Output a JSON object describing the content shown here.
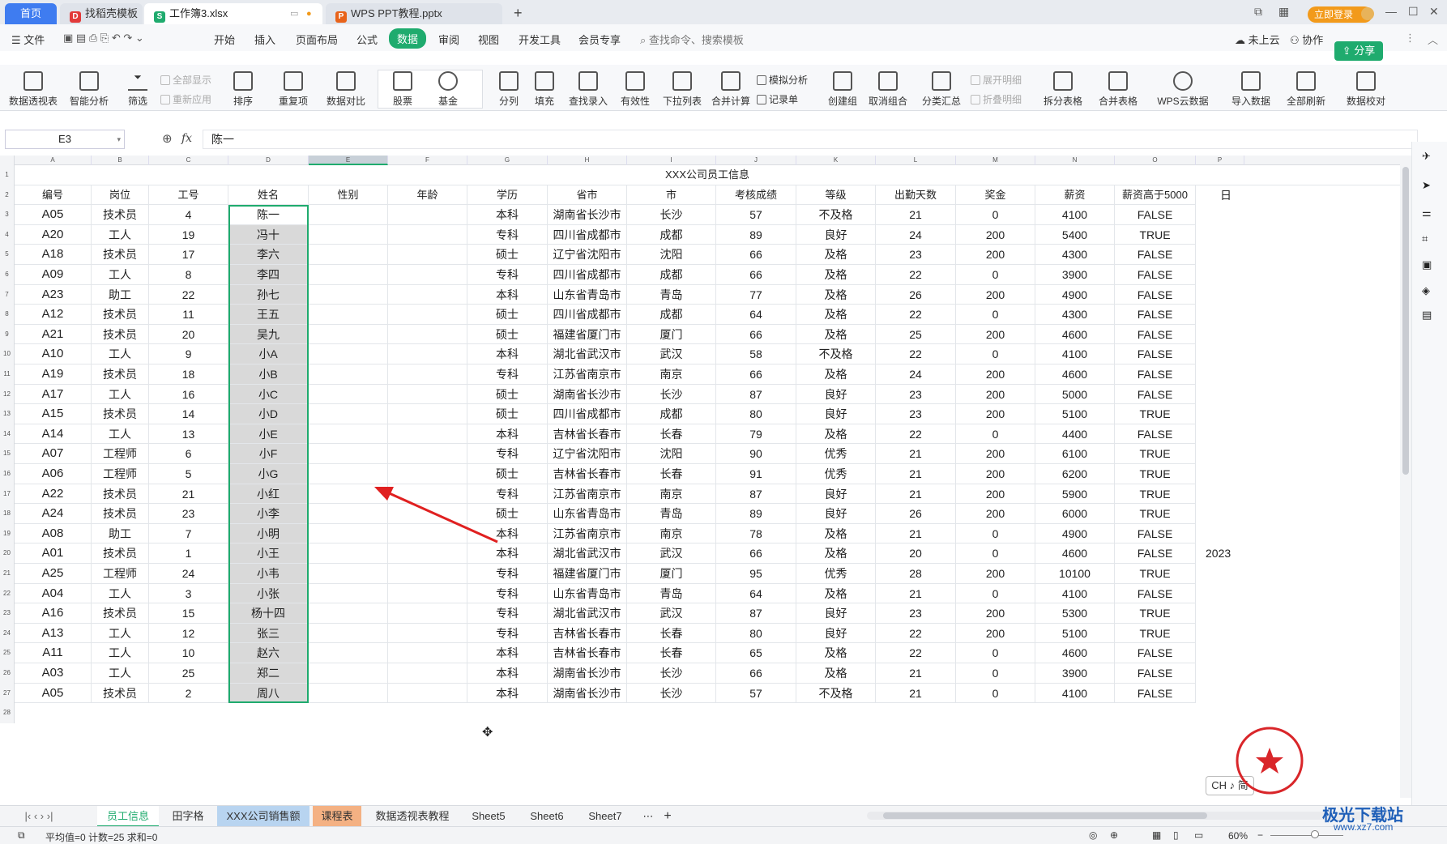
{
  "window": {
    "tabs": [
      {
        "label": "首页"
      },
      {
        "label": "找稻壳模板"
      },
      {
        "label": "工作簿3.xlsx"
      },
      {
        "label": "WPS PPT教程.pptx"
      }
    ],
    "login_label": "立即登录"
  },
  "menu": {
    "file": "文件",
    "items": [
      "开始",
      "插入",
      "页面布局",
      "公式",
      "数据",
      "审阅",
      "视图",
      "开发工具",
      "会员专享"
    ],
    "search_placeholder": "查找命令、搜索模板",
    "cloud": "未上云",
    "collab": "协作",
    "share": "分享"
  },
  "ribbon": {
    "big": [
      "数据透视表",
      "智能分析",
      "筛选",
      "排序",
      "重复项",
      "数据对比",
      "股票",
      "基金",
      "分列",
      "填充",
      "查找录入",
      "有效性",
      "下拉列表",
      "合并计算",
      "创建组",
      "取消组合",
      "分类汇总",
      "拆分表格",
      "合并表格",
      "WPS云数据",
      "导入数据",
      "全部刷新",
      "数据校对"
    ],
    "small": {
      "show_all": "全部显示",
      "reapply": "重新应用",
      "simulate": "模拟分析",
      "record": "记录单",
      "expand": "展开明细",
      "collapse": "折叠明细"
    }
  },
  "formula_bar": {
    "cell_ref": "E3",
    "fx": "fx",
    "value": "陈一"
  },
  "sheet": {
    "col_letters": [
      "A",
      "B",
      "C",
      "D",
      "E",
      "F",
      "G",
      "H",
      "I",
      "J",
      "K",
      "L",
      "M",
      "N",
      "O",
      "P"
    ],
    "title": "XXX公司员工信息",
    "headers": [
      "编号",
      "岗位",
      "工号",
      "姓名",
      "性别",
      "年龄",
      "学历",
      "省市",
      "市",
      "考核成绩",
      "等级",
      "出勤天数",
      "奖金",
      "薪资",
      "薪资高于5000"
    ],
    "rows": [
      [
        "A05",
        "技术员",
        "4",
        "陈一",
        "",
        "",
        "本科",
        "湖南省长沙市",
        "长沙",
        "57",
        "不及格",
        "21",
        "0",
        "4100",
        "FALSE"
      ],
      [
        "A20",
        "工人",
        "19",
        "冯十",
        "",
        "",
        "专科",
        "四川省成都市",
        "成都",
        "89",
        "良好",
        "24",
        "200",
        "5400",
        "TRUE"
      ],
      [
        "A18",
        "技术员",
        "17",
        "李六",
        "",
        "",
        "硕士",
        "辽宁省沈阳市",
        "沈阳",
        "66",
        "及格",
        "23",
        "200",
        "4300",
        "FALSE"
      ],
      [
        "A09",
        "工人",
        "8",
        "李四",
        "",
        "",
        "专科",
        "四川省成都市",
        "成都",
        "66",
        "及格",
        "22",
        "0",
        "3900",
        "FALSE"
      ],
      [
        "A23",
        "助工",
        "22",
        "孙七",
        "",
        "",
        "本科",
        "山东省青岛市",
        "青岛",
        "77",
        "及格",
        "26",
        "200",
        "4900",
        "FALSE"
      ],
      [
        "A12",
        "技术员",
        "11",
        "王五",
        "",
        "",
        "硕士",
        "四川省成都市",
        "成都",
        "64",
        "及格",
        "22",
        "0",
        "4300",
        "FALSE"
      ],
      [
        "A21",
        "技术员",
        "20",
        "吴九",
        "",
        "",
        "硕士",
        "福建省厦门市",
        "厦门",
        "66",
        "及格",
        "25",
        "200",
        "4600",
        "FALSE"
      ],
      [
        "A10",
        "工人",
        "9",
        "小A",
        "",
        "",
        "本科",
        "湖北省武汉市",
        "武汉",
        "58",
        "不及格",
        "22",
        "0",
        "4100",
        "FALSE"
      ],
      [
        "A19",
        "技术员",
        "18",
        "小B",
        "",
        "",
        "专科",
        "江苏省南京市",
        "南京",
        "66",
        "及格",
        "24",
        "200",
        "4600",
        "FALSE"
      ],
      [
        "A17",
        "工人",
        "16",
        "小C",
        "",
        "",
        "硕士",
        "湖南省长沙市",
        "长沙",
        "87",
        "良好",
        "23",
        "200",
        "5000",
        "FALSE"
      ],
      [
        "A15",
        "技术员",
        "14",
        "小D",
        "",
        "",
        "硕士",
        "四川省成都市",
        "成都",
        "80",
        "良好",
        "23",
        "200",
        "5100",
        "TRUE"
      ],
      [
        "A14",
        "工人",
        "13",
        "小E",
        "",
        "",
        "本科",
        "吉林省长春市",
        "长春",
        "79",
        "及格",
        "22",
        "0",
        "4400",
        "FALSE"
      ],
      [
        "A07",
        "工程师",
        "6",
        "小F",
        "",
        "",
        "专科",
        "辽宁省沈阳市",
        "沈阳",
        "90",
        "优秀",
        "21",
        "200",
        "6100",
        "TRUE"
      ],
      [
        "A06",
        "工程师",
        "5",
        "小G",
        "",
        "",
        "硕士",
        "吉林省长春市",
        "长春",
        "91",
        "优秀",
        "21",
        "200",
        "6200",
        "TRUE"
      ],
      [
        "A22",
        "技术员",
        "21",
        "小红",
        "",
        "",
        "专科",
        "江苏省南京市",
        "南京",
        "87",
        "良好",
        "21",
        "200",
        "5900",
        "TRUE"
      ],
      [
        "A24",
        "技术员",
        "23",
        "小李",
        "",
        "",
        "硕士",
        "山东省青岛市",
        "青岛",
        "89",
        "良好",
        "26",
        "200",
        "6000",
        "TRUE"
      ],
      [
        "A08",
        "助工",
        "7",
        "小明",
        "",
        "",
        "本科",
        "江苏省南京市",
        "南京",
        "78",
        "及格",
        "21",
        "0",
        "4900",
        "FALSE"
      ],
      [
        "A01",
        "技术员",
        "1",
        "小王",
        "",
        "",
        "本科",
        "湖北省武汉市",
        "武汉",
        "66",
        "及格",
        "20",
        "0",
        "4600",
        "FALSE"
      ],
      [
        "A25",
        "工程师",
        "24",
        "小韦",
        "",
        "",
        "专科",
        "福建省厦门市",
        "厦门",
        "95",
        "优秀",
        "28",
        "200",
        "10100",
        "TRUE"
      ],
      [
        "A04",
        "工人",
        "3",
        "小张",
        "",
        "",
        "专科",
        "山东省青岛市",
        "青岛",
        "64",
        "及格",
        "21",
        "0",
        "4100",
        "FALSE"
      ],
      [
        "A16",
        "技术员",
        "15",
        "杨十四",
        "",
        "",
        "专科",
        "湖北省武汉市",
        "武汉",
        "87",
        "良好",
        "23",
        "200",
        "5300",
        "TRUE"
      ],
      [
        "A13",
        "工人",
        "12",
        "张三",
        "",
        "",
        "专科",
        "吉林省长春市",
        "长春",
        "80",
        "良好",
        "22",
        "200",
        "5100",
        "TRUE"
      ],
      [
        "A11",
        "工人",
        "10",
        "赵六",
        "",
        "",
        "本科",
        "吉林省长春市",
        "长春",
        "65",
        "及格",
        "22",
        "0",
        "4600",
        "FALSE"
      ],
      [
        "A03",
        "工人",
        "25",
        "郑二",
        "",
        "",
        "本科",
        "湖南省长沙市",
        "长沙",
        "66",
        "及格",
        "21",
        "0",
        "3900",
        "FALSE"
      ],
      [
        "A05",
        "技术员",
        "2",
        "周八",
        "",
        "",
        "本科",
        "湖南省长沙市",
        "长沙",
        "57",
        "不及格",
        "21",
        "0",
        "4100",
        "FALSE"
      ]
    ],
    "overflow_q2": "日",
    "overflow_q20": "2023"
  },
  "sheet_tabs": [
    "员工信息",
    "田字格",
    "XXX公司销售额",
    "课程表",
    "数据透视表教程",
    "Sheet5",
    "Sheet6",
    "Sheet7"
  ],
  "status": {
    "summary": "平均值=0  计数=25  求和=0",
    "zoom": "60%"
  },
  "ime": "CH ♪ 简",
  "watermark": {
    "name": "极光下载站",
    "url": "www.xz7.com"
  },
  "colors": {
    "accent": "#1fab6e",
    "home_tab": "#3f7cf0",
    "arrow": "#e02020"
  }
}
